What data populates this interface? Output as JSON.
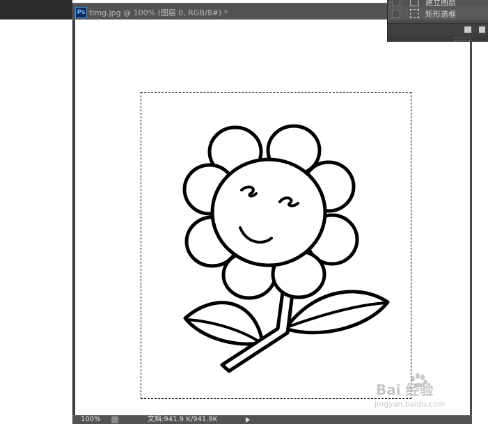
{
  "document": {
    "title": "timg.jpg @ 100% (图层 0, RGB/8#) *",
    "app_badge": "Ps"
  },
  "status_bar": {
    "zoom": "100%",
    "doc_info": "文档:941.9 K/941.9K"
  },
  "layers_panel": {
    "items": [
      {
        "label": "建立图层",
        "icon": "layer-icon"
      },
      {
        "label": "矩形选框",
        "icon": "rect-marquee-icon"
      }
    ]
  },
  "watermark": {
    "main": "Bai 经验",
    "sub": "jingyan.baidu.com"
  },
  "colors": {
    "workspace": "#2b2b2b",
    "panel": "#535353",
    "canvas": "#ffffff",
    "ps_blue": "#3f8ee6"
  }
}
